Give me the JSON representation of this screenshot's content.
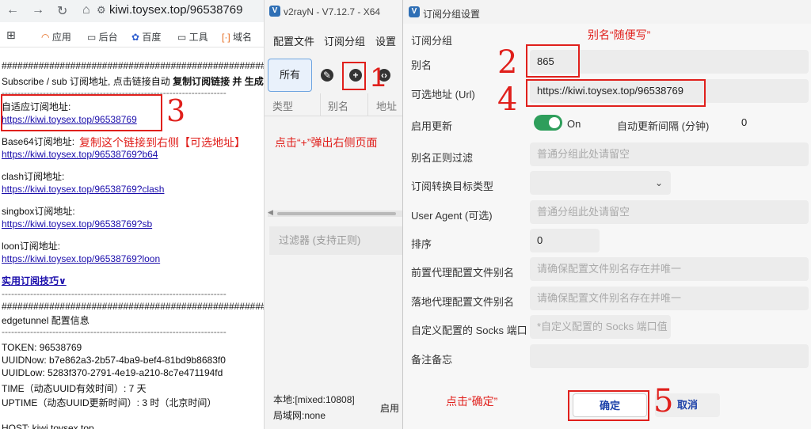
{
  "browser": {
    "url": "kiwi.toysex.top/96538769",
    "bookmarks": [
      "应用",
      "后台",
      "百度",
      "工具",
      "域名"
    ],
    "hash_line": "########################################################",
    "intro": "Subscribe / sub 订阅地址, 点击链接自动 ",
    "intro_bold": "复制订阅链接 并 生成订",
    "dash_line": "-----------------------------------------------------------------------",
    "sections": [
      {
        "label": "自适应订阅地址:",
        "link": "https://kiwi.toysex.top/96538769"
      },
      {
        "label": "Base64订阅地址:",
        "link": "https://kiwi.toysex.top/96538769?b64"
      },
      {
        "label": "clash订阅地址:",
        "link": "https://kiwi.toysex.top/96538769?clash"
      },
      {
        "label": "singbox订阅地址:",
        "link": "https://kiwi.toysex.top/96538769?sb"
      },
      {
        "label": "loon订阅地址:",
        "link": "https://kiwi.toysex.top/96538769?loon"
      }
    ],
    "tips_link": "实用订阅技巧∨",
    "edgetunnel": "edgetunnel 配置信息",
    "info": [
      "TOKEN: 96538769",
      "UUIDNow: b7e862a3-2b57-4ba9-bef4-81bd9b8683f0",
      "UUIDLow: 5283f370-2791-4e19-a210-8c7e471194fd",
      "TIME（动态UUID有效时间）: 7 天",
      "UPTIME（动态UUID更新时间）: 3 时（北京时间）",
      "HOST: kiwi.toysex.top"
    ]
  },
  "v2rayn": {
    "title": "v2rayN - V7.12.7 - X64",
    "menu": [
      "配置文件",
      "订阅分组",
      "设置"
    ],
    "all_tab": "所有",
    "columns": [
      "类型",
      "别名",
      "地址"
    ],
    "filter_placeholder": "过滤器 (支持正则)",
    "status_local": "本地:[mixed:10808]",
    "status_lan": "局域网:none",
    "status_enable": "启用"
  },
  "dialog": {
    "title": "订阅分组设置",
    "section": "订阅分组",
    "alias_label": "别名",
    "alias_value": "865",
    "url_label": "可选地址 (Url)",
    "url_value": "https://kiwi.toysex.top/96538769",
    "enable_update_label": "启用更新",
    "toggle_state": "On",
    "auto_interval_label": "自动更新间隔 (分钟)",
    "auto_interval_value": "0",
    "alias_regex_label": "别名正则过滤",
    "alias_regex_placeholder": "普通分组此处请留空",
    "convert_target_label": "订阅转换目标类型",
    "user_agent_label": "User Agent (可选)",
    "user_agent_placeholder": "普通分组此处请留空",
    "sort_label": "排序",
    "sort_value": "0",
    "prev_proxy_label": "前置代理配置文件别名",
    "prev_proxy_placeholder": "请确保配置文件别名存在并唯一",
    "landing_proxy_label": "落地代理配置文件别名",
    "landing_proxy_placeholder": "请确保配置文件别名存在并唯一",
    "socks_label": "自定义配置的 Socks 端口",
    "socks_placeholder": "*自定义配置的 Socks 端口值",
    "memo_label": "备注备忘",
    "ok_label": "确定",
    "cancel_label": "取消"
  },
  "annotations": {
    "alias_hint": "别名“随便写”",
    "copy_hint": "复制这个链接到右侧【可选地址】",
    "plus_hint": "点击“+”弹出右侧页面",
    "ok_hint": "点击“确定”",
    "num1": "1",
    "num2": "2",
    "num3": "3",
    "num4": "4",
    "num5": "5"
  },
  "colors": {
    "annotation_red": "#e0201c",
    "toggle_green": "#2e9e5b",
    "link_blue": "#1a0dab",
    "cancel_blue": "#1a3fa8"
  }
}
